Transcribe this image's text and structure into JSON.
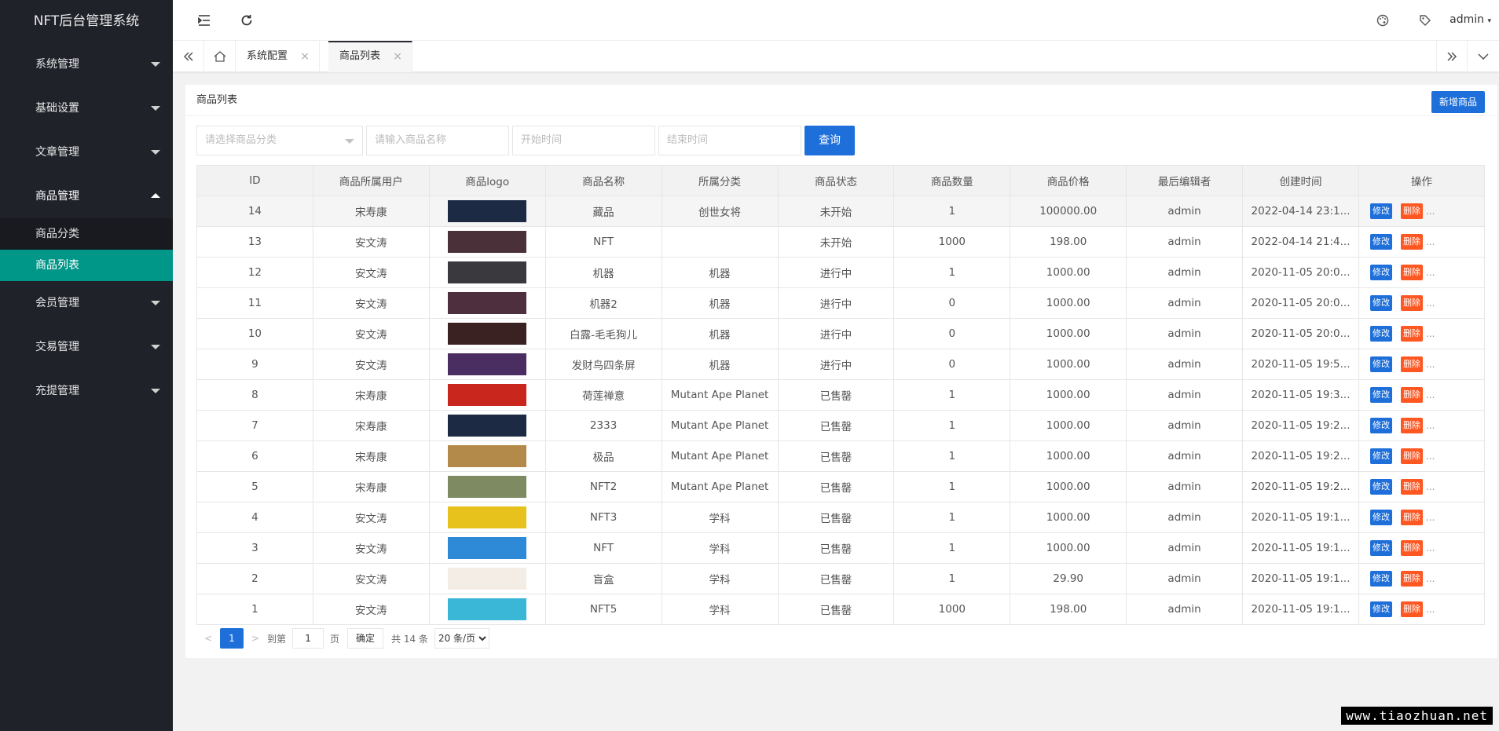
{
  "app": {
    "title": "NFT后台管理系统",
    "user": "admin"
  },
  "sidebar": {
    "items": [
      {
        "label": "系统管理"
      },
      {
        "label": "基础设置"
      },
      {
        "label": "文章管理"
      },
      {
        "label": "商品管理",
        "children": [
          "商品分类",
          "商品列表"
        ]
      },
      {
        "label": "会员管理"
      },
      {
        "label": "交易管理"
      },
      {
        "label": "充提管理"
      }
    ]
  },
  "tabs": [
    {
      "label": "系统配置"
    },
    {
      "label": "商品列表"
    }
  ],
  "card": {
    "title": "商品列表",
    "add_button": "新增商品",
    "filters": {
      "category_placeholder": "请选择商品分类",
      "name_placeholder": "请输入商品名称",
      "start_placeholder": "开始时间",
      "end_placeholder": "结束时间",
      "search_button": "查询"
    }
  },
  "table": {
    "headers": [
      "ID",
      "商品所属用户",
      "商品logo",
      "商品名称",
      "所属分类",
      "商品状态",
      "商品数量",
      "商品价格",
      "最后编辑者",
      "创建时间",
      "操作"
    ],
    "edit_label": "修改",
    "delete_label": "删除",
    "more_label": "...",
    "rows": [
      {
        "id": "14",
        "user": "宋寿康",
        "thumb": "#1c2a44",
        "name": "藏品",
        "category": "创世女将",
        "status": "未开始",
        "qty": "1",
        "price": "100000.00",
        "editor": "admin",
        "created": "2022-04-14 23:1..."
      },
      {
        "id": "13",
        "user": "安文涛",
        "thumb": "#4a3038",
        "name": "NFT",
        "category": "",
        "status": "未开始",
        "qty": "1000",
        "price": "198.00",
        "editor": "admin",
        "created": "2022-04-14 21:4..."
      },
      {
        "id": "12",
        "user": "安文涛",
        "thumb": "#3a3a3e",
        "name": "机器",
        "category": "机器",
        "status": "进行中",
        "qty": "1",
        "price": "1000.00",
        "editor": "admin",
        "created": "2020-11-05 20:0..."
      },
      {
        "id": "11",
        "user": "安文涛",
        "thumb": "#4d2f3d",
        "name": "机器2",
        "category": "机器",
        "status": "进行中",
        "qty": "0",
        "price": "1000.00",
        "editor": "admin",
        "created": "2020-11-05 20:0..."
      },
      {
        "id": "10",
        "user": "安文涛",
        "thumb": "#3a2222",
        "name": "白露-毛毛狗儿",
        "category": "机器",
        "status": "进行中",
        "qty": "0",
        "price": "1000.00",
        "editor": "admin",
        "created": "2020-11-05 20:0..."
      },
      {
        "id": "9",
        "user": "安文涛",
        "thumb": "#4a2e62",
        "name": "发财鸟四条屏",
        "category": "机器",
        "status": "进行中",
        "qty": "0",
        "price": "1000.00",
        "editor": "admin",
        "created": "2020-11-05 19:5..."
      },
      {
        "id": "8",
        "user": "宋寿康",
        "thumb": "#c9261e",
        "name": "荷莲禅意",
        "category": "Mutant Ape Planet",
        "status": "已售罄",
        "qty": "1",
        "price": "1000.00",
        "editor": "admin",
        "created": "2020-11-05 19:3..."
      },
      {
        "id": "7",
        "user": "宋寿康",
        "thumb": "#1c2a44",
        "name": "2333",
        "category": "Mutant Ape Planet",
        "status": "已售罄",
        "qty": "1",
        "price": "1000.00",
        "editor": "admin",
        "created": "2020-11-05 19:2..."
      },
      {
        "id": "6",
        "user": "宋寿康",
        "thumb": "#b38a4a",
        "name": "极品",
        "category": "Mutant Ape Planet",
        "status": "已售罄",
        "qty": "1",
        "price": "1000.00",
        "editor": "admin",
        "created": "2020-11-05 19:2..."
      },
      {
        "id": "5",
        "user": "宋寿康",
        "thumb": "#7d8a62",
        "name": "NFT2",
        "category": "Mutant Ape Planet",
        "status": "已售罄",
        "qty": "1",
        "price": "1000.00",
        "editor": "admin",
        "created": "2020-11-05 19:2..."
      },
      {
        "id": "4",
        "user": "安文涛",
        "thumb": "#e8c21c",
        "name": "NFT3",
        "category": "学科",
        "status": "已售罄",
        "qty": "1",
        "price": "1000.00",
        "editor": "admin",
        "created": "2020-11-05 19:1..."
      },
      {
        "id": "3",
        "user": "安文涛",
        "thumb": "#2e8ad6",
        "name": "NFT",
        "category": "学科",
        "status": "已售罄",
        "qty": "1",
        "price": "1000.00",
        "editor": "admin",
        "created": "2020-11-05 19:1..."
      },
      {
        "id": "2",
        "user": "安文涛",
        "thumb": "#f4ede6",
        "name": "盲盒",
        "category": "学科",
        "status": "已售罄",
        "qty": "1",
        "price": "29.90",
        "editor": "admin",
        "created": "2020-11-05 19:1..."
      },
      {
        "id": "1",
        "user": "安文涛",
        "thumb": "#3ab6d6",
        "name": "NFT5",
        "category": "学科",
        "status": "已售罄",
        "qty": "1000",
        "price": "198.00",
        "editor": "admin",
        "created": "2020-11-05 19:1..."
      }
    ]
  },
  "pager": {
    "current": "1",
    "goto_label": "到第",
    "goto_value": "1",
    "page_label": "页",
    "confirm_label": "确定",
    "total_label": "共 14 条",
    "page_size": "20 条/页"
  },
  "watermark": "www.tiaozhuan.net"
}
